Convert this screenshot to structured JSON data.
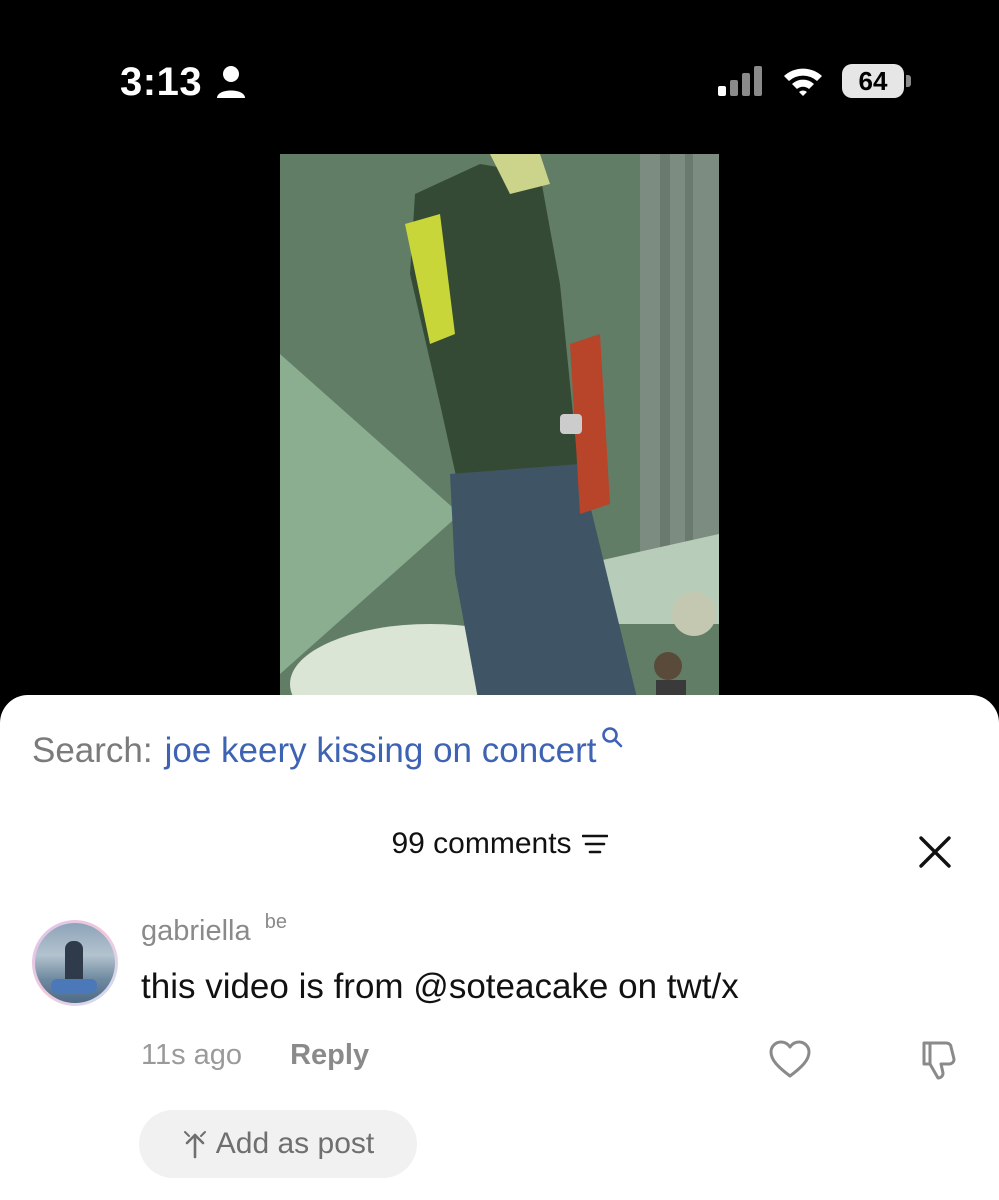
{
  "status_bar": {
    "time": "3:13",
    "battery": "64",
    "icons": [
      "person-icon",
      "signal-icon",
      "wifi-icon",
      "battery-icon"
    ]
  },
  "search": {
    "label": "Search:",
    "query": "joe keery kissing on concert"
  },
  "comments": {
    "title": "99 comments",
    "items": [
      {
        "username": "gabriella",
        "tag": "be",
        "text": "this video is from @soteacake on twt/x",
        "time": "11s ago",
        "reply_label": "Reply",
        "add_as_post_label": "Add as post"
      }
    ]
  },
  "colors": {
    "search_query": "#3f63b3",
    "muted": "#8a8a8a",
    "pill_bg": "#f1f1f1"
  }
}
